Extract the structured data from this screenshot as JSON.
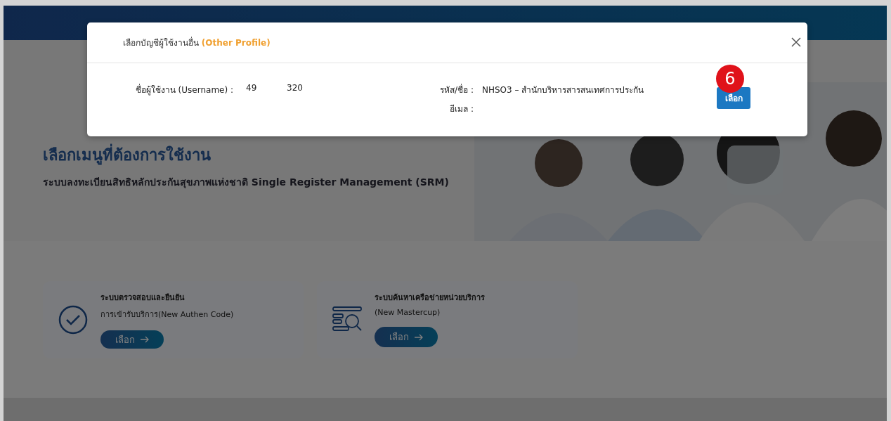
{
  "modal": {
    "title": "เลือกบัญชีผู้ใช้งานอื่น",
    "title_note": "(Other Profile)",
    "username_label": "ชื่อผู้ใช้งาน (Username) :",
    "username_parts": [
      "49",
      "320"
    ],
    "code_label": "รหัส/ชื่อ :",
    "code_value": "NHSO3 – สำนักบริหารสารสนเทศการประกัน",
    "email_label": "อีเมล :",
    "select_button": "เลือก",
    "step_badge": "6"
  },
  "page": {
    "heading": "เลือกเมนูที่ต้องการใช้งาน",
    "subheading": "ระบบลงทะเบียนสิทธิหลักประกันสุขภาพแห่งชาติ Single Register Management (SRM)"
  },
  "cards": [
    {
      "kind": "check",
      "title": "ระบบตรวจสอบและยืนยัน",
      "subtitle": "การเข้ารับบริการ(New Authen Code)",
      "button": "เลือก"
    },
    {
      "kind": "search-list",
      "title": "ระบบค้นหาเครือข่ายหน่วยบริการ",
      "subtitle": "(New Mastercup)",
      "button": "เลือก"
    }
  ]
}
